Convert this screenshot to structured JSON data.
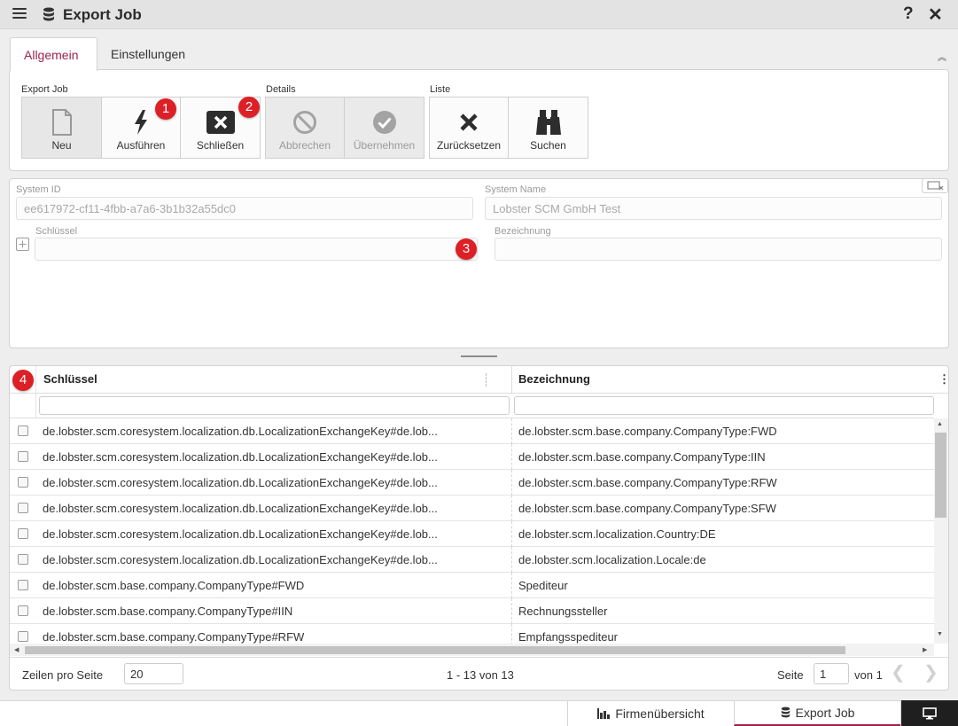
{
  "window": {
    "title": "Export Job",
    "menu_icon": "hamburger-icon",
    "db_icon": "database-icon",
    "help": "?",
    "close": "✕"
  },
  "tabs": [
    {
      "label": "Allgemein",
      "active": true
    },
    {
      "label": "Einstellungen",
      "active": false
    }
  ],
  "toolbar": {
    "groups": {
      "export_job": "Export Job",
      "details": "Details",
      "liste": "Liste"
    },
    "buttons": {
      "neu": "Neu",
      "ausfuehren": "Ausführen",
      "schliessen": "Schließen",
      "abbrechen": "Abbrechen",
      "uebernehmen": "Übernehmen",
      "zuruecksetzen": "Zurücksetzen",
      "suchen": "Suchen"
    }
  },
  "badges": {
    "b1": "1",
    "b2": "2",
    "b3": "3",
    "b4": "4"
  },
  "form": {
    "system_id_label": "System ID",
    "system_id_value": "ee617972-cf11-4fbb-a7a6-3b1b32a55dc0",
    "system_name_label": "System Name",
    "system_name_value": "Lobster SCM GmbH Test",
    "schluessel_label": "Schlüssel",
    "schluessel_value": "",
    "bezeichnung_label": "Bezeichnung",
    "bezeichnung_value": ""
  },
  "table": {
    "columns": [
      "Schlüssel",
      "Bezeichnung"
    ],
    "rows": [
      {
        "key": "de.lobster.scm.coresystem.localization.db.LocalizationExchangeKey#de.lob...",
        "label": "de.lobster.scm.base.company.CompanyType:FWD"
      },
      {
        "key": "de.lobster.scm.coresystem.localization.db.LocalizationExchangeKey#de.lob...",
        "label": "de.lobster.scm.base.company.CompanyType:IIN"
      },
      {
        "key": "de.lobster.scm.coresystem.localization.db.LocalizationExchangeKey#de.lob...",
        "label": "de.lobster.scm.base.company.CompanyType:RFW"
      },
      {
        "key": "de.lobster.scm.coresystem.localization.db.LocalizationExchangeKey#de.lob...",
        "label": "de.lobster.scm.base.company.CompanyType:SFW"
      },
      {
        "key": "de.lobster.scm.coresystem.localization.db.LocalizationExchangeKey#de.lob...",
        "label": "de.lobster.scm.localization.Country:DE"
      },
      {
        "key": "de.lobster.scm.coresystem.localization.db.LocalizationExchangeKey#de.lob...",
        "label": "de.lobster.scm.localization.Locale:de"
      },
      {
        "key": "de.lobster.scm.base.company.CompanyType#FWD",
        "label": "Spediteur"
      },
      {
        "key": "de.lobster.scm.base.company.CompanyType#IIN",
        "label": "Rechnungssteller"
      },
      {
        "key": "de.lobster.scm.base.company.CompanyType#RFW",
        "label": "Empfangsspediteur"
      }
    ]
  },
  "pager": {
    "rows_label": "Zeilen pro Seite",
    "rows_value": "20",
    "range": "1 - 13 von 13",
    "page_label": "Seite",
    "page_value": "1",
    "of_label": "von 1"
  },
  "footer": {
    "tab1": "Firmenübersicht",
    "tab2": "Export Job"
  },
  "colors": {
    "accent": "#a0224a",
    "badge": "#dd1f26"
  }
}
